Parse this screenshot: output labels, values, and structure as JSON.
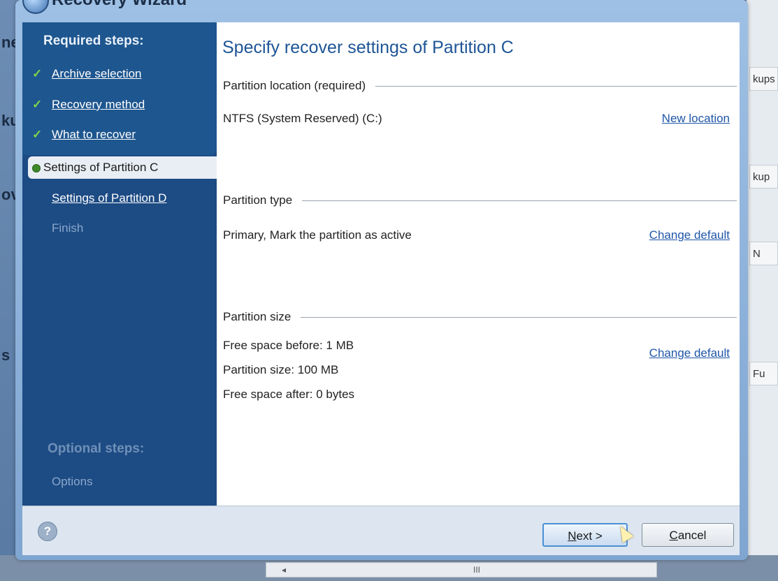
{
  "window": {
    "title": "Recovery Wizard"
  },
  "background": {
    "left_texts": [
      "ne",
      "ku",
      "ov",
      "s"
    ],
    "right_strips": [
      "kups",
      "kup",
      "N",
      "Fu"
    ],
    "scrollbar": {
      "arrow": "◂",
      "grip": "III"
    }
  },
  "sidebar": {
    "required_heading": "Required steps:",
    "completed": [
      "Archive selection",
      "Recovery method",
      "What to recover"
    ],
    "current": "Settings of Partition C",
    "next": "Settings of Partition D",
    "finish": "Finish",
    "optional_heading": "Optional steps:",
    "optional": [
      "Options"
    ]
  },
  "content": {
    "title": "Specify recover settings of Partition C",
    "location": {
      "label": "Partition location (required)",
      "value": "NTFS (System Reserved) (C:)",
      "link": "New location"
    },
    "type": {
      "label": "Partition type",
      "value": "Primary, Mark the partition as active",
      "link": "Change default"
    },
    "size": {
      "label": "Partition size",
      "free_before": "Free space before: 1 MB",
      "partition_size": "Partition size: 100 MB",
      "free_after": "Free space after: 0 bytes",
      "link": "Change default"
    }
  },
  "footer": {
    "help": "?",
    "next_button": {
      "accel": "N",
      "rest": "ext >"
    },
    "cancel_button": {
      "accel": "C",
      "rest": "ancel"
    }
  },
  "colors": {
    "sidebar": "#1d4b84",
    "link": "#1f55a8",
    "check": "#7fd24a",
    "title": "#1e5596"
  }
}
